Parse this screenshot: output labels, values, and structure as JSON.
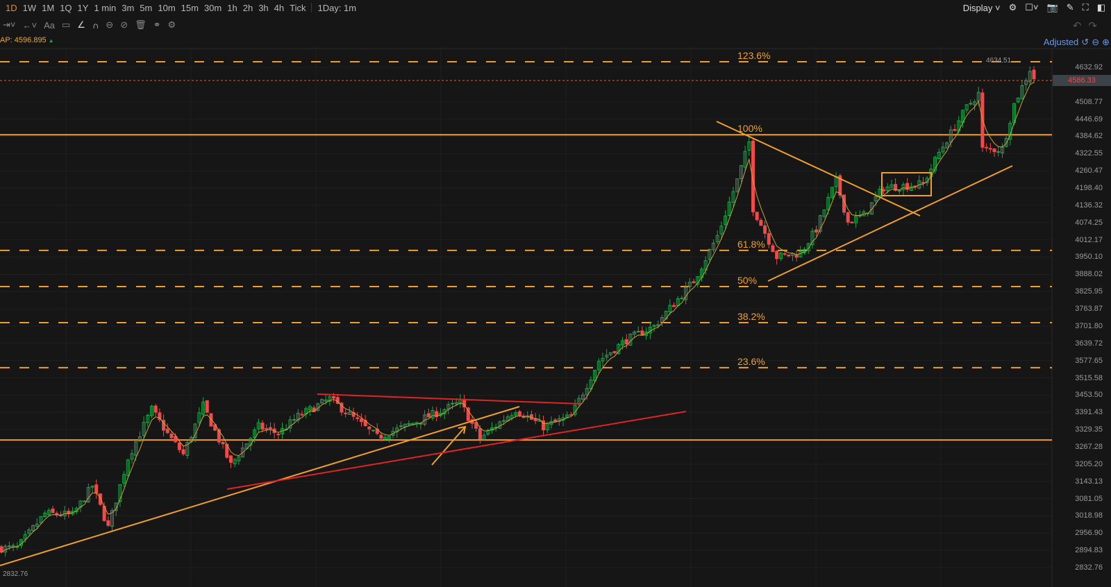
{
  "toolbar": {
    "intervals": [
      "1D",
      "1W",
      "1M",
      "1Q",
      "1Y",
      "1 min",
      "3m",
      "5m",
      "10m",
      "15m",
      "30m",
      "1h",
      "2h",
      "3h",
      "4h",
      "Tick"
    ],
    "active": "1D",
    "session": "1Day: 1m",
    "display": "Display"
  },
  "indicator": {
    "label": "AP:",
    "value": "4596.895"
  },
  "adjusted": "Adjusted",
  "colors": {
    "up": "#1fa34a",
    "down": "#ef4b4b",
    "fib": "#f0a02a",
    "trend_red": "#e02424",
    "bg": "#161616"
  },
  "chart_data": {
    "type": "candlestick",
    "y_ticks": [
      "4632.92",
      "4508.77",
      "4446.69",
      "4384.62",
      "4322.55",
      "4260.47",
      "4198.40",
      "4136.32",
      "4074.25",
      "4012.17",
      "3950.10",
      "3888.02",
      "3825.95",
      "3763.87",
      "3701.80",
      "3639.72",
      "3577.65",
      "3515.58",
      "3453.50",
      "3391.43",
      "3329.35",
      "3267.28",
      "3205.20",
      "3143.13",
      "3081.05",
      "3018.98",
      "2956.90",
      "2894.83",
      "2832.76"
    ],
    "ylim": [
      2832.76,
      4632.92
    ],
    "last_price": "4586.33",
    "high_label": "4634.51",
    "low_label": "2832.76",
    "fib_levels": [
      {
        "label": "123.6%",
        "price": 4653
      },
      {
        "label": "100%",
        "price": 4390
      },
      {
        "label": "61.8%",
        "price": 3974
      },
      {
        "label": "50%",
        "price": 3844
      },
      {
        "label": "38.2%",
        "price": 3714
      },
      {
        "label": "23.6%",
        "price": 3552
      }
    ],
    "support_levels": [
      4390,
      3292
    ],
    "close_waypoints": [
      [
        0,
        2903
      ],
      [
        4,
        2903
      ],
      [
        11,
        3027
      ],
      [
        18,
        3022
      ],
      [
        23,
        3127
      ],
      [
        27,
        2977
      ],
      [
        32,
        3227
      ],
      [
        38,
        3402
      ],
      [
        42,
        3314
      ],
      [
        46,
        3240
      ],
      [
        51,
        3415
      ],
      [
        58,
        3202
      ],
      [
        65,
        3340
      ],
      [
        70,
        3315
      ],
      [
        75,
        3377
      ],
      [
        83,
        3440
      ],
      [
        95,
        3302
      ],
      [
        102,
        3340
      ],
      [
        116,
        3427
      ],
      [
        121,
        3297
      ],
      [
        130,
        3402
      ],
      [
        137,
        3340
      ],
      [
        144,
        3377
      ],
      [
        151,
        3577
      ],
      [
        158,
        3652
      ],
      [
        165,
        3701
      ],
      [
        175,
        3864
      ],
      [
        181,
        4026
      ],
      [
        186,
        4226
      ],
      [
        189,
        4363
      ],
      [
        190,
        4126
      ],
      [
        196,
        3951
      ],
      [
        202,
        3964
      ],
      [
        206,
        4051
      ],
      [
        211,
        4226
      ],
      [
        214,
        4076
      ],
      [
        218,
        4101
      ],
      [
        223,
        4201
      ],
      [
        228,
        4206
      ],
      [
        233,
        4213
      ],
      [
        237,
        4326
      ],
      [
        244,
        4488
      ],
      [
        247,
        4538
      ],
      [
        248,
        4338
      ],
      [
        253,
        4338
      ],
      [
        256,
        4500
      ],
      [
        260,
        4625
      ],
      [
        261,
        4595
      ]
    ]
  }
}
